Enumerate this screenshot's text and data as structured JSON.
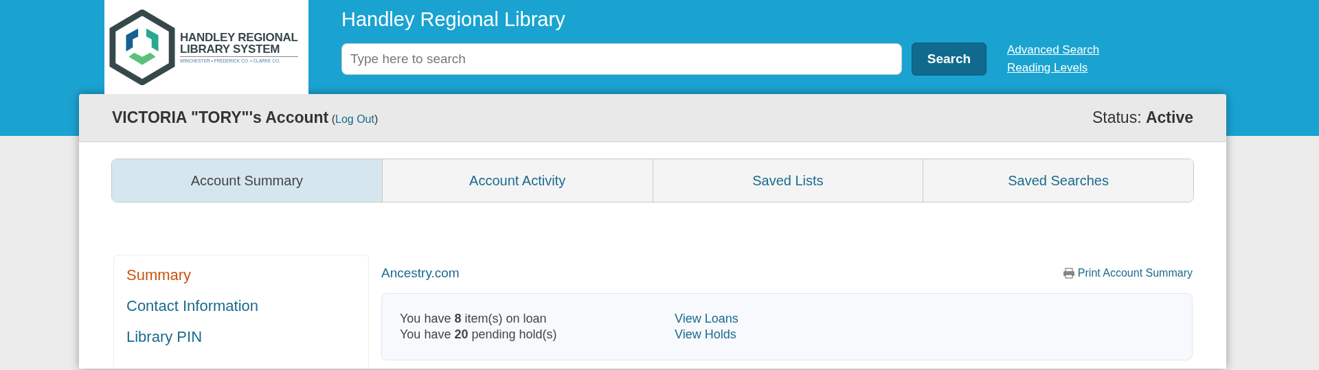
{
  "logo": {
    "line_1": "HANDLEY REGIONAL",
    "line_2": "LIBRARY SYSTEM",
    "tagline": "WINCHESTER • FREDERICK CO. • CLARKE CO."
  },
  "header": {
    "title": "Handley Regional Library",
    "search": {
      "placeholder": "Type here to search"
    },
    "search_button": "Search",
    "links": [
      "Advanced Search",
      "Reading Levels"
    ]
  },
  "account": {
    "name": "VICTORIA \"TORY\"'s Account",
    "logout_open": "(",
    "logout": "Log Out",
    "logout_close": ")",
    "status_label": "Status:",
    "status": "Active"
  },
  "tabs": [
    {
      "label": "Account Summary",
      "selected": true
    },
    {
      "label": "Account Activity",
      "selected": false
    },
    {
      "label": "Saved Lists",
      "selected": false
    },
    {
      "label": "Saved Searches",
      "selected": false
    }
  ],
  "sidebar": {
    "items": [
      {
        "label": "Summary",
        "selected": true
      },
      {
        "label": "Contact Information",
        "selected": false
      },
      {
        "label": "Library PIN",
        "selected": false
      }
    ]
  },
  "content": {
    "link": "Ancestry.com",
    "print": "Print Account Summary",
    "summary": [
      {
        "text": "You have **8** item(s) on loan",
        "link": "View Loans"
      },
      {
        "text": "You have **20** pending hold(s)",
        "link": "View Holds"
      }
    ]
  }
}
